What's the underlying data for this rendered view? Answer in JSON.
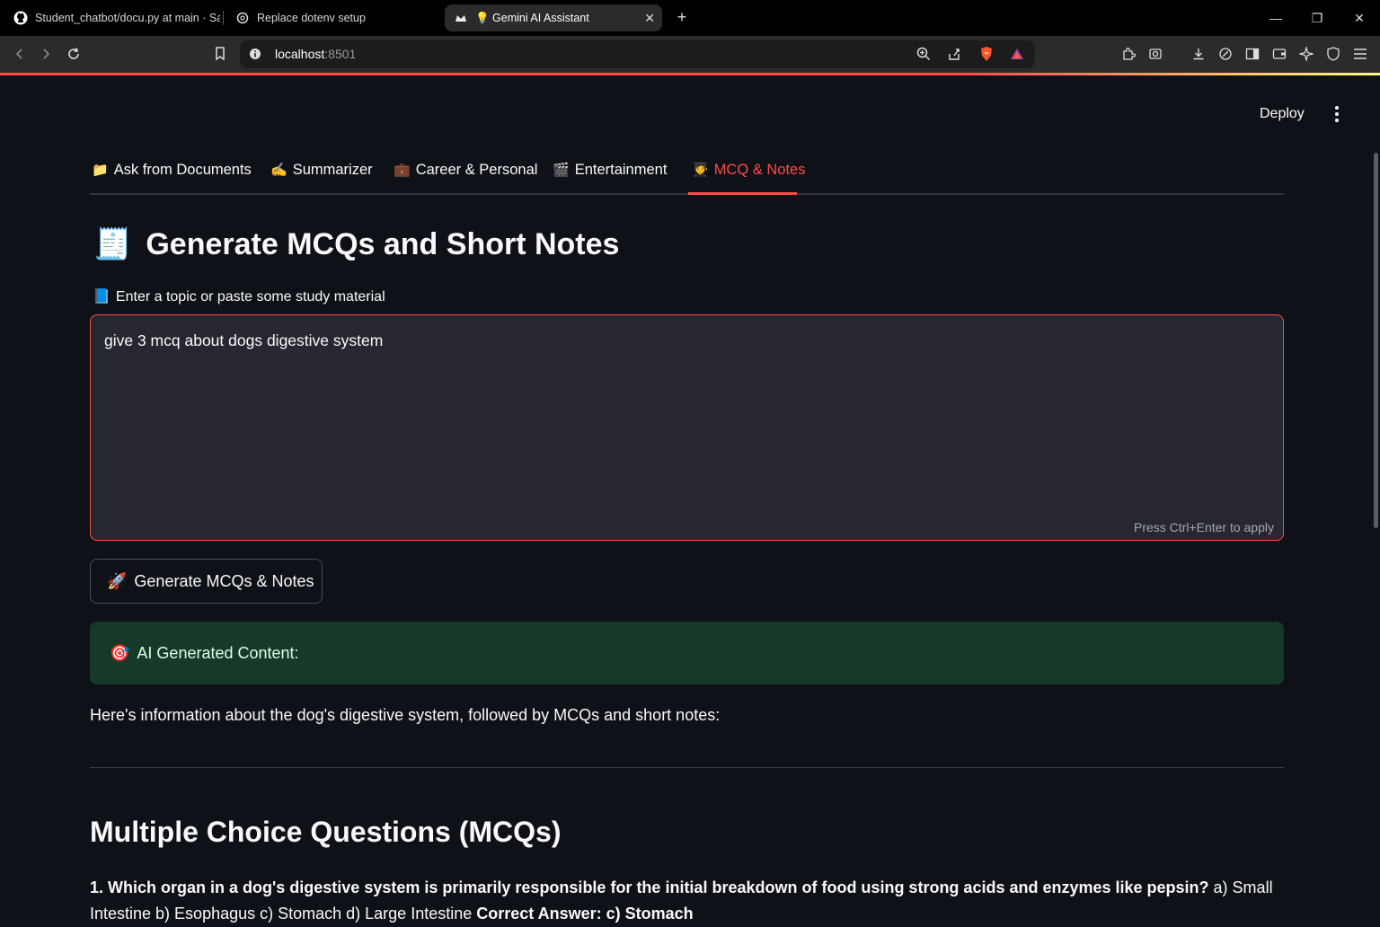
{
  "browser": {
    "tabs": [
      {
        "title": "Student_chatbot/docu.py at main · Sa",
        "icon": "github-icon"
      },
      {
        "title": "Replace dotenv setup",
        "icon": "openai-icon"
      },
      {
        "title": "💡 Gemini AI Assistant",
        "icon": "streamlit-icon",
        "active": true
      }
    ],
    "url_host": "localhost",
    "url_port": ":8501"
  },
  "app": {
    "deploy_label": "Deploy",
    "tabs": [
      {
        "emoji": "📁",
        "label": "Ask from Documents"
      },
      {
        "emoji": "✍️",
        "label": "Summarizer"
      },
      {
        "emoji": "💼",
        "label": "Career & Personal"
      },
      {
        "emoji": "🎬",
        "label": "Entertainment"
      },
      {
        "emoji": "🧑‍🎓",
        "label": "MCQ & Notes",
        "active": true
      }
    ],
    "title_emoji": "🧾",
    "title": "Generate MCQs and Short Notes",
    "input_label_emoji": "📘",
    "input_label": "Enter a topic or paste some study material",
    "input_value": "give 3 mcq about dogs digestive system",
    "input_hint": "Press Ctrl+Enter to apply",
    "button_emoji": "🚀",
    "button_label": "Generate MCQs & Notes",
    "success_emoji": "🎯",
    "success_label": "AI Generated Content:",
    "intro": "Here's information about the dog's digestive system, followed by MCQs and short notes:",
    "mcq_heading": "Multiple Choice Questions (MCQs)",
    "q1_question": "1. Which organ in a dog's digestive system is primarily responsible for the initial breakdown of food using strong acids and enzymes like pepsin?",
    "q1_options": " a) Small Intestine b) Esophagus c) Stomach d) Large Intestine ",
    "q1_answer": "Correct Answer: c) Stomach"
  },
  "colors": {
    "accent": "#ff4b4b",
    "background": "#0e1117",
    "success_bg": "#173928"
  }
}
